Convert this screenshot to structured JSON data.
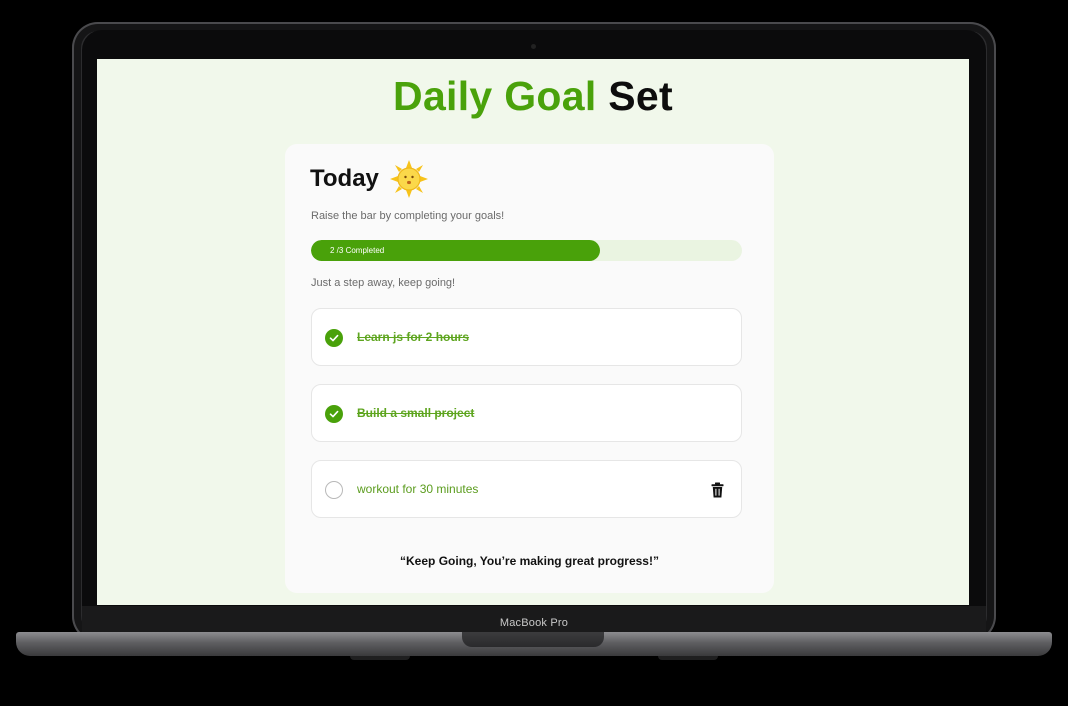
{
  "app": {
    "title_part1": "Daily Goal",
    "title_part2": "Set"
  },
  "card": {
    "heading": "Today",
    "heading_icon": "sun-icon",
    "subtitle": "Raise the bar by completing your goals!",
    "progress": {
      "label": "2 /3 Completed",
      "completed": 2,
      "total": 3,
      "fill_fraction": 0.67,
      "color": "#49a10a"
    },
    "encouragement": "Just a step away, keep going!",
    "goals": [
      {
        "label": "Learn js for 2 hours",
        "done": true
      },
      {
        "label": "Build a small project",
        "done": true
      },
      {
        "label": "workout for 30 minutes",
        "done": false,
        "action_icon": "trash-icon"
      }
    ],
    "quote": "“Keep Going, You’re making great progress!”"
  },
  "device": {
    "label": "MacBook Pro"
  },
  "colors": {
    "accent": "#4aa20b",
    "screen_bg": "#f1f8eb"
  }
}
